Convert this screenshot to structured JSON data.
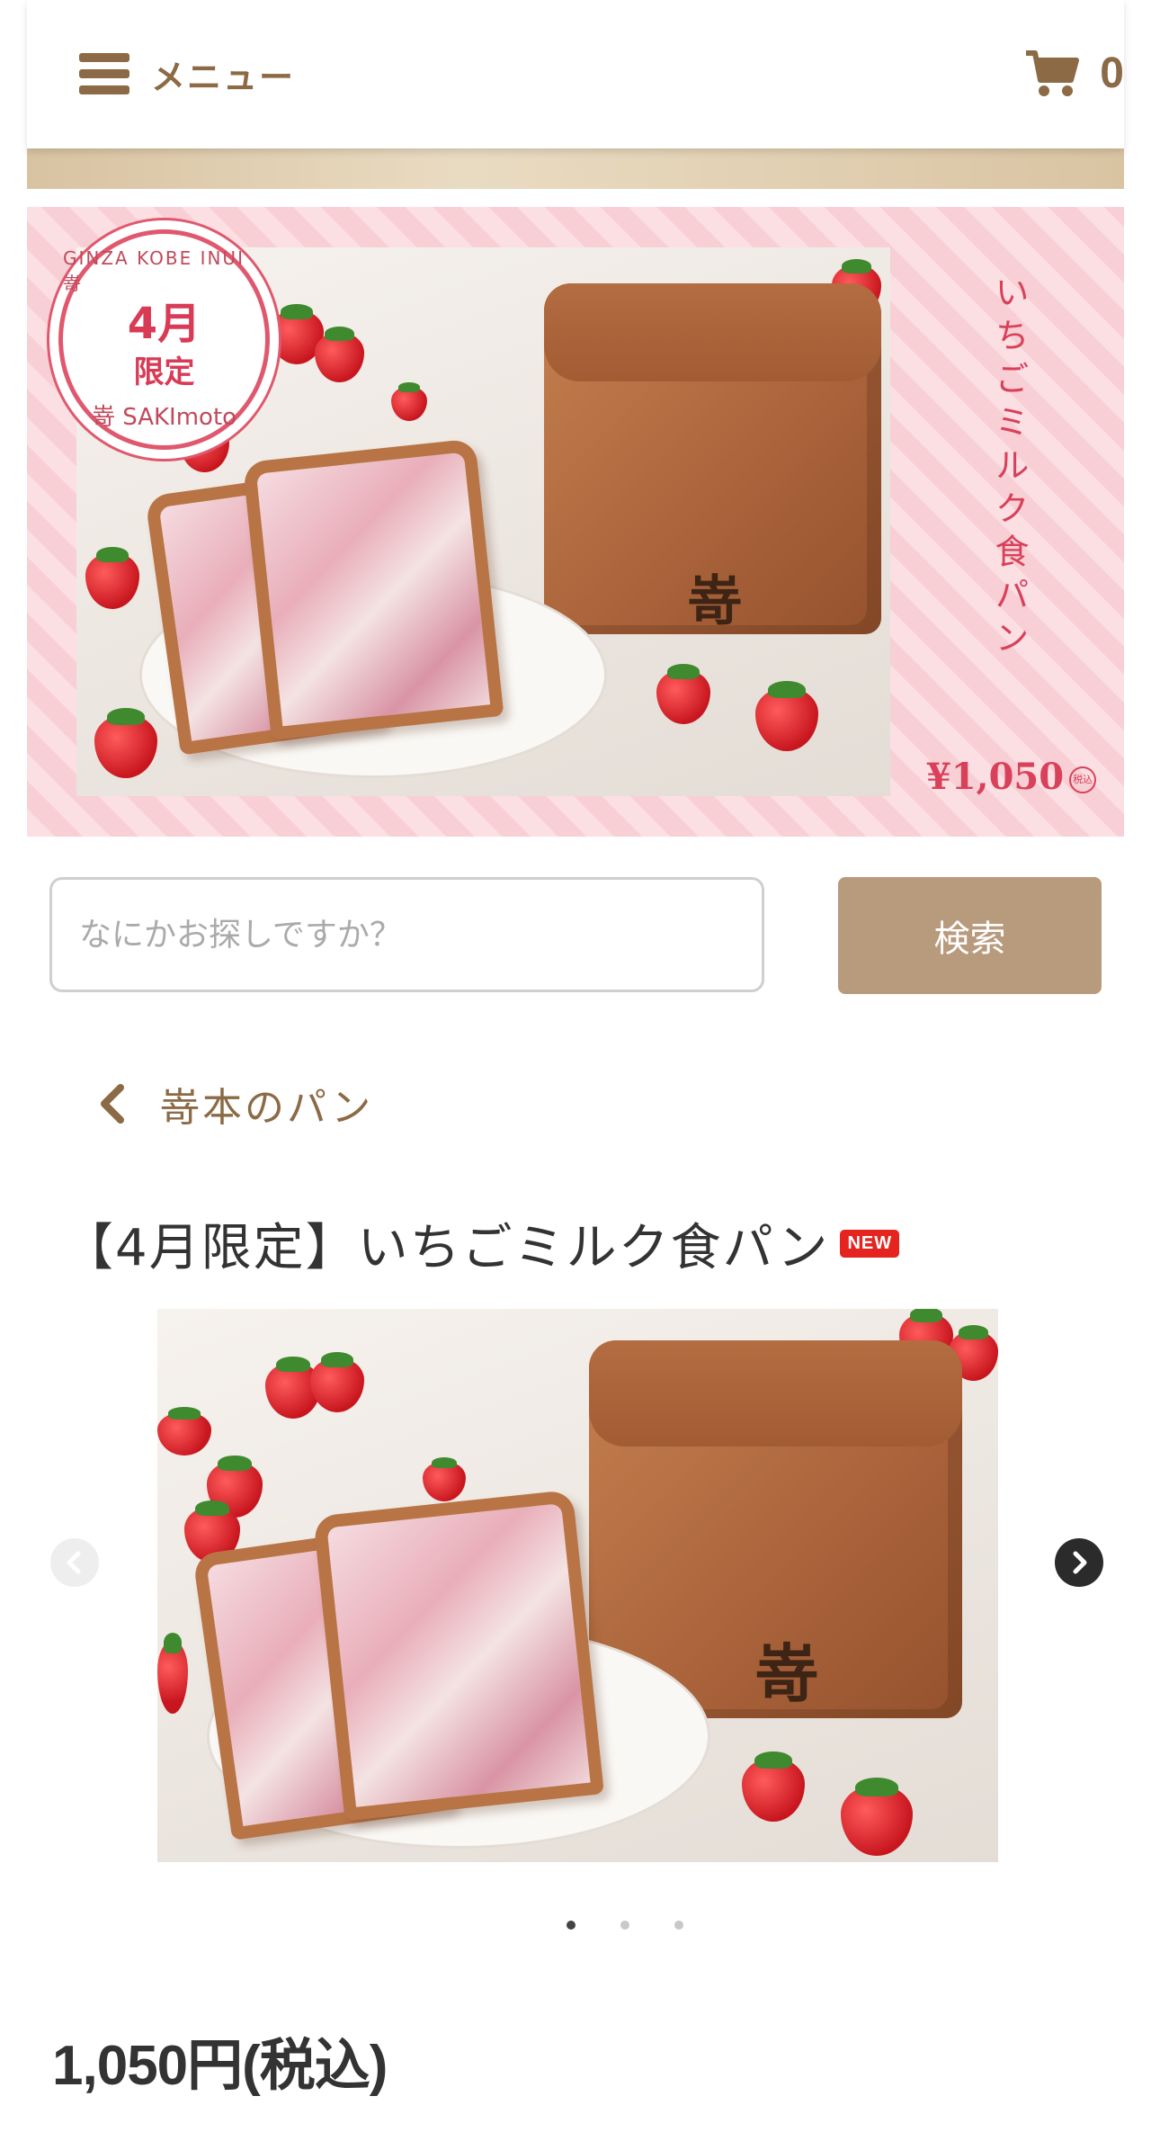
{
  "header": {
    "menu_label": "メニュー",
    "cart_count": "0"
  },
  "banner": {
    "badge_brand": "GINZA KOBE INUI 嵜",
    "badge_month": "4月",
    "badge_limit": "限定",
    "badge_logo": "嵜 SAKImoto",
    "title_vertical": "いちごミルク食パン",
    "price": "¥1,050",
    "tax_label": "税込",
    "loaf_stamp": "嵜"
  },
  "search": {
    "placeholder": "なにかお探しですか？",
    "button_label": "検索"
  },
  "breadcrumb": {
    "label": "嵜本のパン"
  },
  "product": {
    "title": "【4月限定】いちごミルク食パン",
    "new_badge": "NEW",
    "loaf_stamp": "嵜",
    "price": "1,050円(税込)",
    "carousel": {
      "slide_count": 3,
      "active_index": 0
    }
  },
  "colors": {
    "brand_brown": "#8b6a45",
    "search_button": "#b89a7d",
    "banner_pink": "#f7cfd4",
    "banner_text": "#d9405a",
    "new_badge": "#e52420"
  }
}
